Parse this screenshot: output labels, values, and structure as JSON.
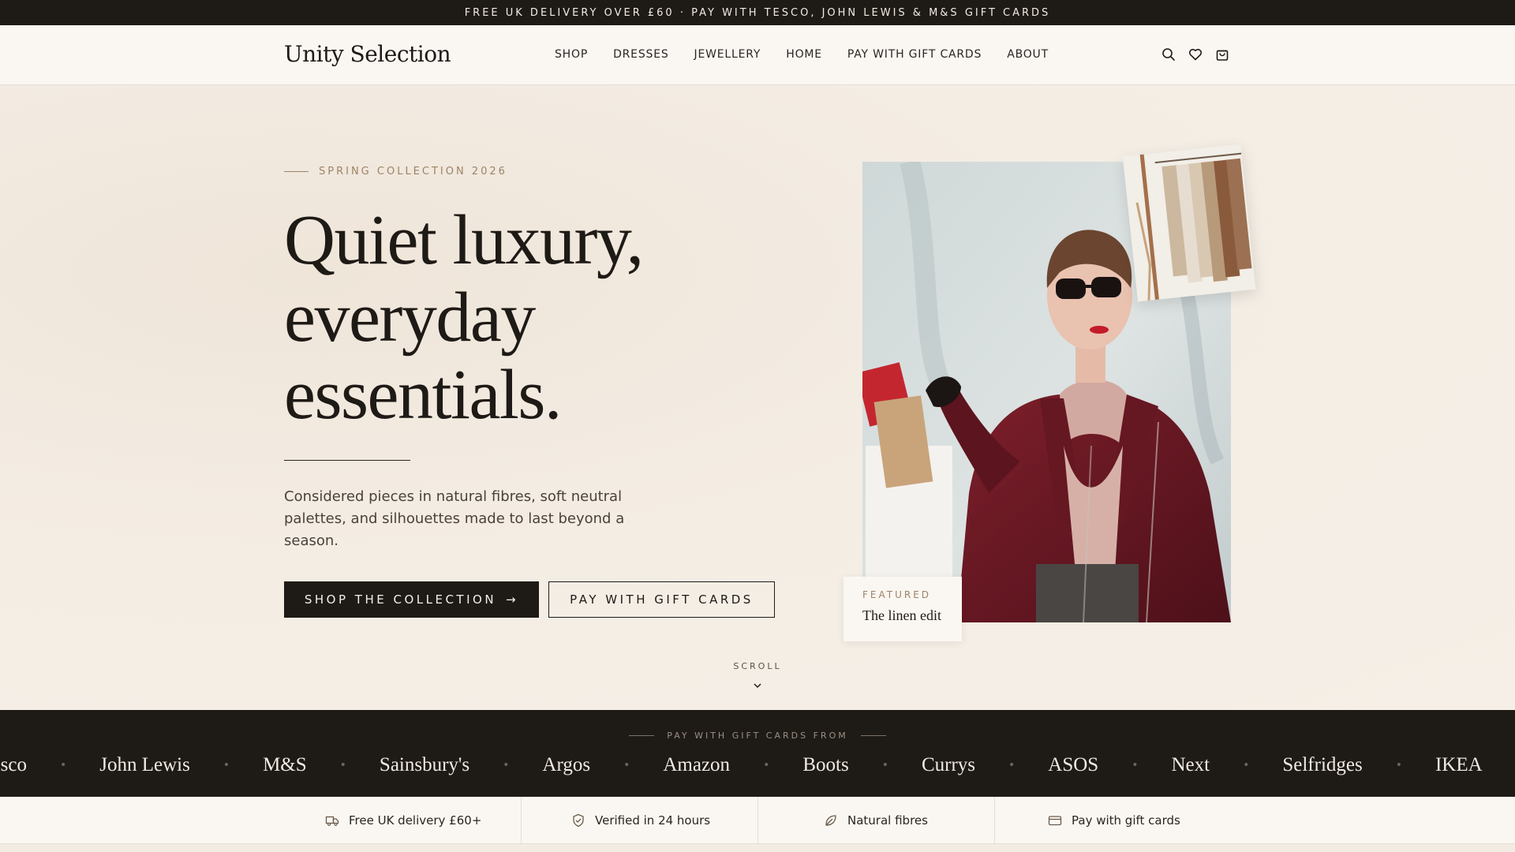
{
  "announcement": "FREE UK DELIVERY OVER £60 · PAY WITH TESCO, JOHN LEWIS & M&S GIFT CARDS",
  "header": {
    "logo": "Unity Selection",
    "nav": [
      "SHOP",
      "DRESSES",
      "JEWELLERY",
      "HOME",
      "PAY WITH GIFT CARDS",
      "ABOUT"
    ],
    "icons": [
      "search-icon",
      "heart-icon",
      "bag-icon"
    ]
  },
  "hero": {
    "eyebrow": "SPRING COLLECTION 2026",
    "headline": [
      "Quiet luxury,",
      "everyday",
      "essentials."
    ],
    "lede": "Considered pieces in natural fibres, soft neutral palettes, and silhouettes made to last beyond a season.",
    "primary_cta": "SHOP THE COLLECTION",
    "primary_cta_arrow": "→",
    "secondary_cta": "PAY WITH GIFT CARDS",
    "scroll_label": "SCROLL",
    "featured": {
      "kicker": "FEATURED",
      "title": "The linen edit"
    }
  },
  "partners": {
    "heading": "PAY WITH GIFT CARDS FROM",
    "brands": [
      "Tesco",
      "John Lewis",
      "M&S",
      "Sainsbury's",
      "Argos",
      "Amazon",
      "Boots",
      "Currys",
      "ASOS",
      "Next",
      "Selfridges",
      "IKEA"
    ]
  },
  "features": [
    {
      "icon": "truck-icon",
      "label": "Free UK delivery £60+"
    },
    {
      "icon": "shield-check-icon",
      "label": "Verified in 24 hours"
    },
    {
      "icon": "leaf-icon",
      "label": "Natural fibres"
    },
    {
      "icon": "card-icon",
      "label": "Pay with gift cards"
    }
  ],
  "colors": {
    "ink": "#1e1a16",
    "cream": "#f3ece3",
    "accent": "#9c8466",
    "coat": "#6e1a24"
  }
}
